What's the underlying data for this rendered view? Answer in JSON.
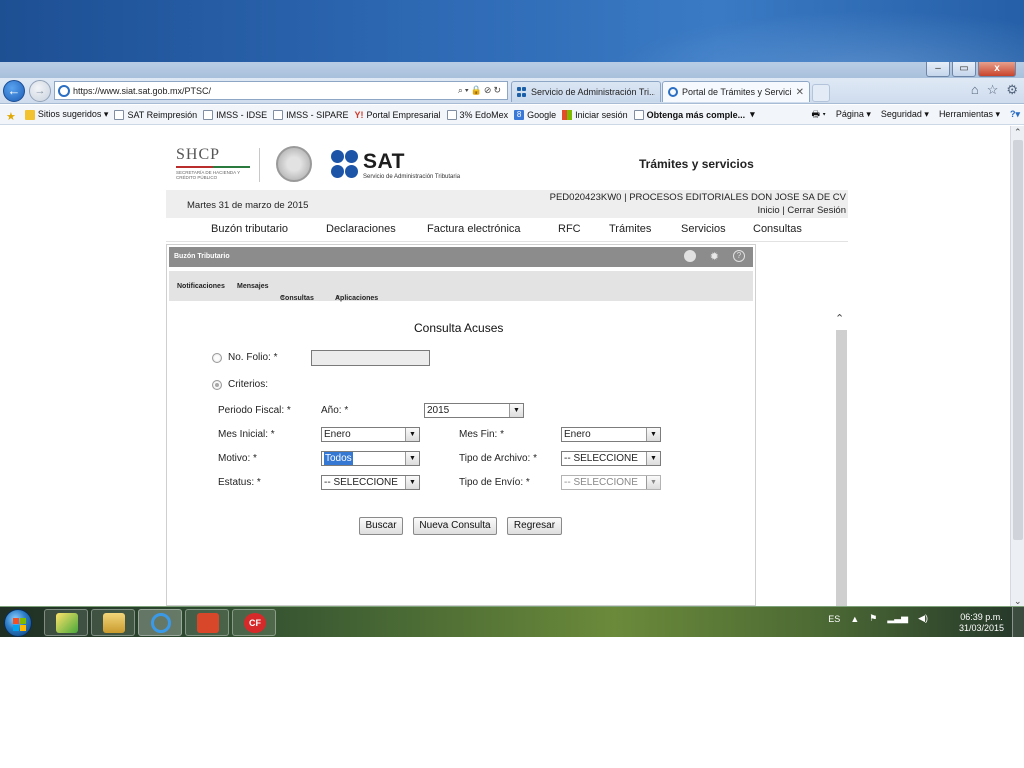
{
  "browser": {
    "window_controls": [
      "–",
      "▭",
      "x"
    ],
    "url": "https://www.siat.sat.gob.mx/PTSC/",
    "tabs": [
      {
        "label": "Servicio de Administración Tri..."
      },
      {
        "label": "Portal de Trámites y Servici..."
      }
    ],
    "favorites": [
      {
        "label": "Sitios sugeridos ▾",
        "icon": "sites-icon"
      },
      {
        "label": "SAT Reimpresión",
        "icon": "page-icon"
      },
      {
        "label": "IMSS - IDSE",
        "icon": "page-icon"
      },
      {
        "label": "IMSS - SIPARE",
        "icon": "page-icon"
      },
      {
        "label": "Portal Empresarial",
        "icon": "yahoo-icon"
      },
      {
        "label": "3% EdoMex",
        "icon": "page-icon"
      },
      {
        "label": "Google",
        "icon": "google-icon"
      },
      {
        "label": "Iniciar sesión",
        "icon": "ms-icon"
      },
      {
        "label": "Obtenga más comple...",
        "icon": "page-icon"
      }
    ],
    "commands": [
      "Página ▾",
      "Seguridad ▾",
      "Herramientas ▾"
    ]
  },
  "header": {
    "shcp": "SHCP",
    "shcp_sub": "SECRETARÍA DE HACIENDA Y CRÉDITO PÚBLICO",
    "sat": "SAT",
    "sat_sub": "Servicio de Administración Tributaria",
    "section_title": "Trámites y servicios"
  },
  "infobar": {
    "date": "Martes 31 de marzo de 2015",
    "rfc": "PED020423KW0 | PROCESOS EDITORIALES DON JOSE SA DE CV",
    "links": "Inicio | Cerrar Sesión"
  },
  "nav": [
    "Buzón tributario",
    "Declaraciones",
    "Factura electrónica",
    "RFC",
    "Trámites",
    "Servicios",
    "Consultas"
  ],
  "panel": {
    "title": "Buzón Tributario",
    "menu": [
      "Notificaciones",
      "Mensajes",
      "Consultas",
      "Aplicaciones"
    ]
  },
  "form": {
    "title": "Consulta Acuses",
    "folio_label": "No. Folio: *",
    "folio_value": "",
    "criterios_label": "Criterios:",
    "periodo_label": "Periodo Fiscal: *",
    "anio_label": "Año: *",
    "anio_value": "2015",
    "mes_inicial_label": "Mes Inicial: *",
    "mes_inicial_value": "Enero",
    "mes_fin_label": "Mes Fin: *",
    "mes_fin_value": "Enero",
    "motivo_label": "Motivo: *",
    "motivo_value": "Todos",
    "tipo_archivo_label": "Tipo de Archivo: *",
    "tipo_archivo_value": "-- SELECCIONE",
    "estatus_label": "Estatus: *",
    "estatus_value": "-- SELECCIONE",
    "tipo_envio_label": "Tipo de Envío: *",
    "tipo_envio_value": "-- SELECCIONE",
    "buttons": {
      "buscar": "Buscar",
      "nueva": "Nueva Consulta",
      "regresar": "Regresar"
    }
  },
  "taskbar": {
    "lang": "ES",
    "time": "06:39 p.m.",
    "date": "31/03/2015"
  },
  "colors": {
    "sat_blue": "#1c54a8",
    "panel_header": "#8c8c8c",
    "selected_option": "#3478d4"
  }
}
